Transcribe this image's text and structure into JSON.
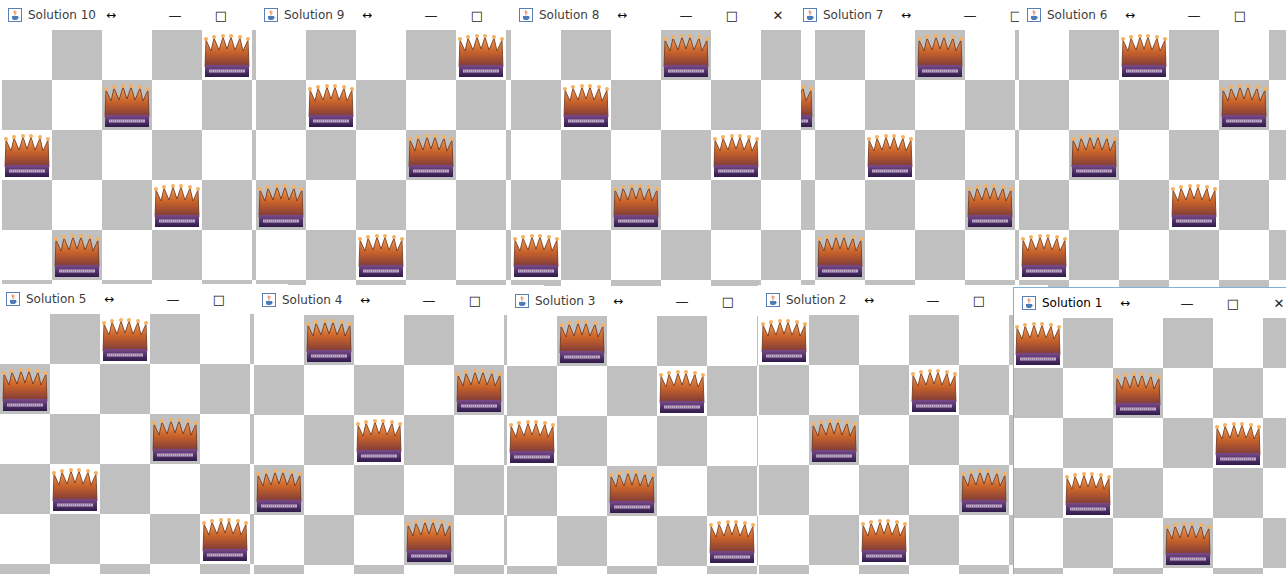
{
  "windows": [
    {
      "title": "Solution 10",
      "resize_glyph": "↔",
      "buttons": [
        "—",
        "□"
      ],
      "active": false,
      "queens": [
        4,
        2,
        0,
        3,
        1
      ]
    },
    {
      "title": "Solution 9",
      "resize_glyph": "↔",
      "buttons": [
        "—",
        "□"
      ],
      "active": false,
      "queens": [
        4,
        1,
        3,
        0,
        2
      ]
    },
    {
      "title": "Solution 8",
      "resize_glyph": "↔",
      "buttons": [
        "—",
        "□",
        "✕"
      ],
      "active": false,
      "queens": [
        3,
        1,
        4,
        2,
        0
      ]
    },
    {
      "title": "Solution 7",
      "resize_glyph": "↔",
      "buttons": [
        "—",
        "□"
      ],
      "active": false,
      "queens": [
        3,
        0,
        2,
        4,
        1
      ]
    },
    {
      "title": "Solution 6",
      "resize_glyph": "↔",
      "buttons": [
        "—",
        "□"
      ],
      "active": false,
      "queens": [
        2,
        4,
        1,
        3,
        0
      ]
    },
    {
      "title": "Solution 5",
      "resize_glyph": "↔",
      "buttons": [
        "—",
        "□"
      ],
      "active": false,
      "queens": [
        2,
        0,
        3,
        1,
        4
      ]
    },
    {
      "title": "Solution 4",
      "resize_glyph": "↔",
      "buttons": [
        "—",
        "□"
      ],
      "active": false,
      "queens": [
        1,
        4,
        2,
        0,
        3
      ]
    },
    {
      "title": "Solution 3",
      "resize_glyph": "↔",
      "buttons": [
        "—",
        "□"
      ],
      "active": false,
      "queens": [
        1,
        3,
        0,
        2,
        4
      ]
    },
    {
      "title": "Solution 2",
      "resize_glyph": "↔",
      "buttons": [
        "—",
        "□"
      ],
      "active": false,
      "queens": [
        0,
        3,
        1,
        4,
        2
      ]
    },
    {
      "title": "Solution 1",
      "resize_glyph": "↔",
      "buttons": [
        "—",
        "□",
        "✕"
      ],
      "active": true,
      "queens": [
        0,
        2,
        4,
        1,
        3
      ]
    }
  ]
}
